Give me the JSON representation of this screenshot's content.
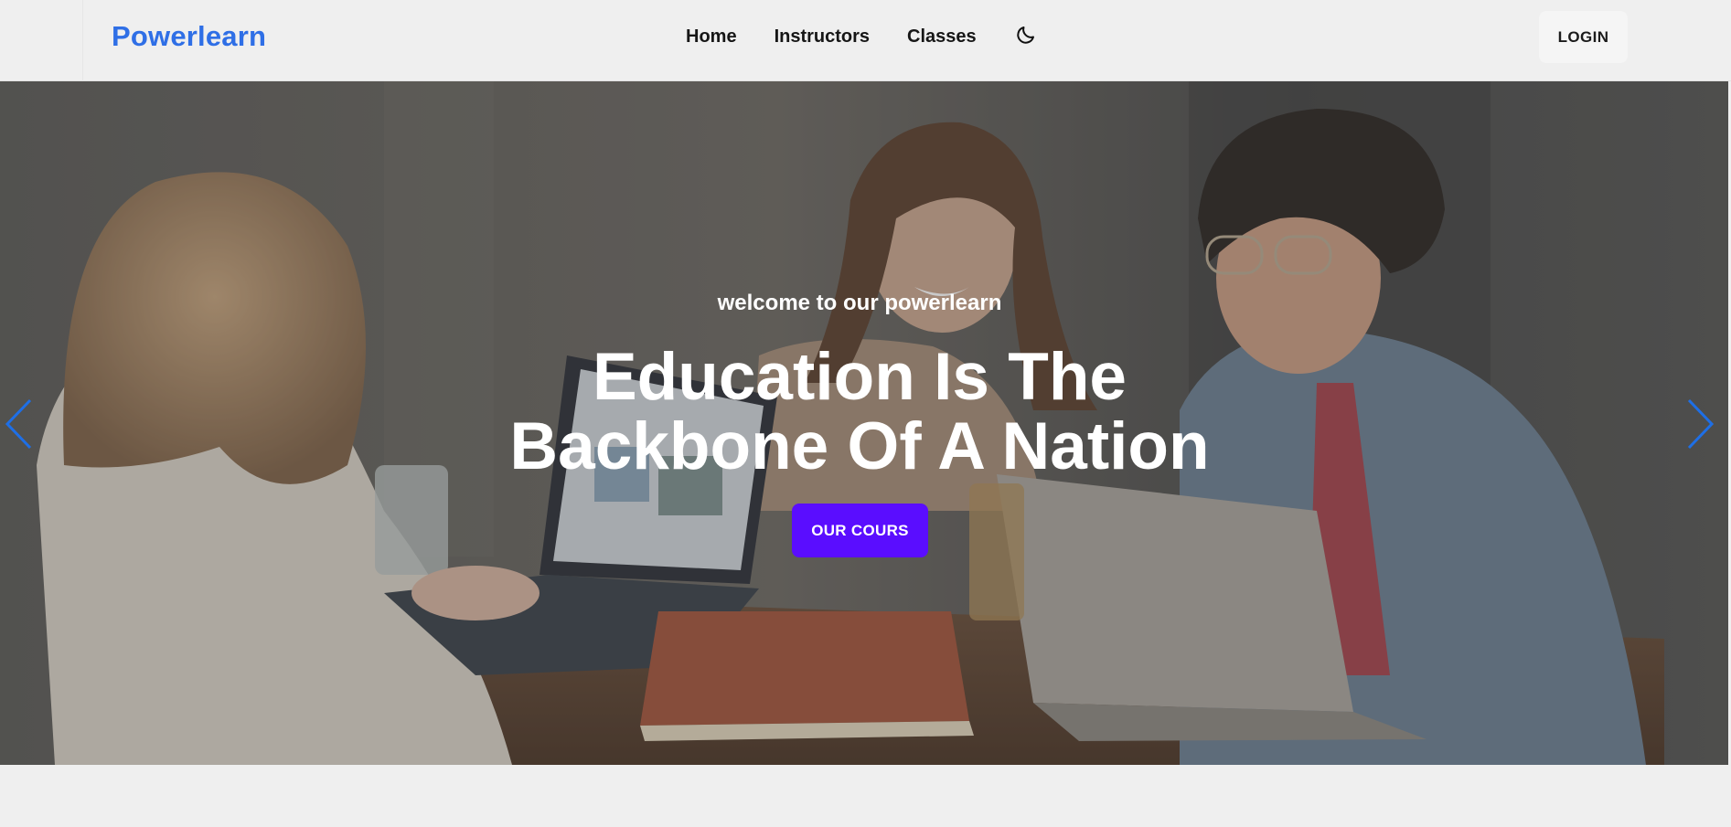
{
  "navbar": {
    "brand": "Powerlearn",
    "links": [
      {
        "label": "Home"
      },
      {
        "label": "Instructors"
      },
      {
        "label": "Classes"
      }
    ],
    "theme_icon": "moon-icon",
    "login_label": "LOGIN"
  },
  "hero": {
    "subtitle": "welcome to our powerlearn",
    "title_line1": "Education Is The",
    "title_line2": "Backbone Of A Nation",
    "cta_label": "OUR COURS",
    "prev_icon": "chevron-left-icon",
    "next_icon": "chevron-right-icon"
  },
  "colors": {
    "brand": "#2f6fe6",
    "cta": "#5a0dff",
    "arrows": "#1e6fe6",
    "page_bg": "#efefef"
  }
}
